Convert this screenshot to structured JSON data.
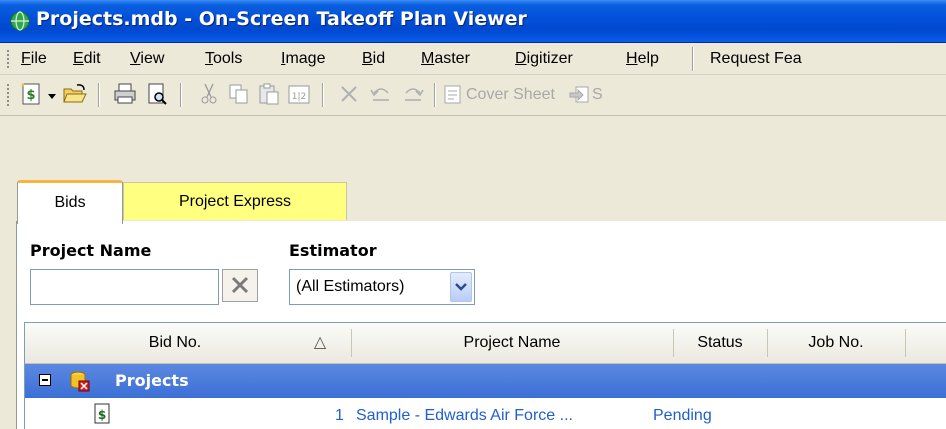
{
  "window": {
    "title": "Projects.mdb - On-Screen Takeoff Plan Viewer"
  },
  "menu": {
    "items": [
      {
        "label_acc": "F",
        "label_rest": "ile"
      },
      {
        "label_acc": "E",
        "label_rest": "dit"
      },
      {
        "label_acc": "V",
        "label_rest": "iew"
      },
      {
        "label_acc": "T",
        "label_rest": "ools"
      },
      {
        "label_acc": "I",
        "label_rest": "mage"
      },
      {
        "label_acc": "B",
        "label_rest": "id"
      },
      {
        "label_acc": "M",
        "label_rest": "aster"
      },
      {
        "label_acc": "D",
        "label_rest": "igitizer"
      },
      {
        "label_acc": "H",
        "label_rest": "elp"
      }
    ],
    "request": "Request Fea"
  },
  "toolbar": {
    "icons": [
      "new-bid-icon",
      "dropdown-arrow-icon",
      "open-folder-icon",
      "print-icon",
      "print-preview-icon",
      "cut-icon",
      "copy-icon",
      "paste-icon",
      "paste-special-icon",
      "delete-icon",
      "undo-icon",
      "redo-icon",
      "cover-sheet-icon",
      "send-icon"
    ],
    "cover_sheet": "Cover Sheet",
    "send_partial": "S"
  },
  "tabs": {
    "bids": "Bids",
    "project_express": "Project Express",
    "highlight_color": "#ffff80",
    "active_accent": "#f7b540"
  },
  "filters": {
    "project_name_label": "Project Name",
    "project_name_value": "",
    "estimator_label": "Estimator",
    "estimator_value": "(All Estimators)"
  },
  "grid": {
    "headers": {
      "bid_no": "Bid No.",
      "sort_indicator": "△",
      "project_name": "Project Name",
      "status": "Status",
      "job_no": "Job No."
    },
    "group": {
      "expander": "−",
      "label": "Projects"
    },
    "rows": [
      {
        "number": "1",
        "project_name": "Sample - Edwards Air Force ...",
        "status": "Pending",
        "job_no": ""
      }
    ],
    "group_color": "#4a7de0",
    "link_color": "#1f5fce"
  }
}
